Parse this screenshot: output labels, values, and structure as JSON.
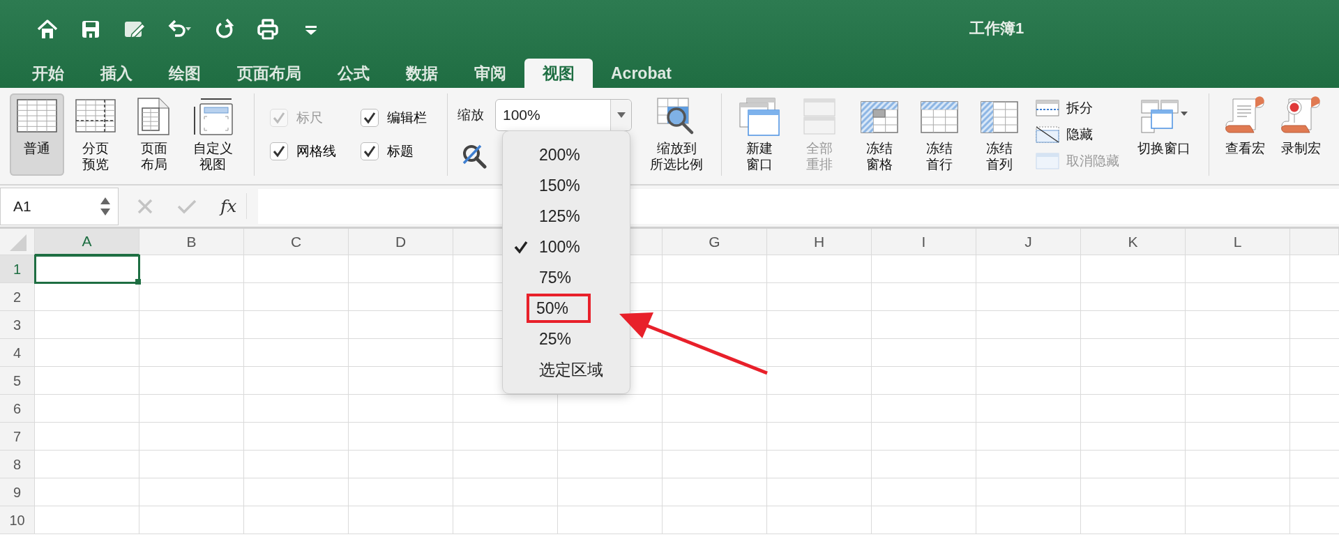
{
  "window": {
    "title": "工作簿1"
  },
  "quick_access": [
    {
      "kind": "home"
    },
    {
      "kind": "save"
    },
    {
      "kind": "edit"
    },
    {
      "kind": "undo"
    },
    {
      "kind": "redo"
    },
    {
      "kind": "print"
    },
    {
      "kind": "customize"
    }
  ],
  "tabs": [
    {
      "label": "开始",
      "selected": false
    },
    {
      "label": "插入",
      "selected": false
    },
    {
      "label": "绘图",
      "selected": false
    },
    {
      "label": "页面布局",
      "selected": false
    },
    {
      "label": "公式",
      "selected": false
    },
    {
      "label": "数据",
      "selected": false
    },
    {
      "label": "审阅",
      "selected": false
    },
    {
      "label": "视图",
      "selected": true
    },
    {
      "label": "Acrobat",
      "selected": false
    }
  ],
  "ribbon": {
    "views": [
      {
        "kind": "normal",
        "lines": [
          "普通"
        ],
        "selected": true
      },
      {
        "kind": "page-break",
        "lines": [
          "分页",
          "预览"
        ],
        "selected": false
      },
      {
        "kind": "page-layout",
        "lines": [
          "页面",
          "布局"
        ],
        "selected": false
      },
      {
        "kind": "custom",
        "lines": [
          "自定义",
          "视图"
        ],
        "selected": false
      }
    ],
    "show": [
      {
        "label": "标尺",
        "checked": true,
        "disabled": true
      },
      {
        "label": "编辑栏",
        "checked": true,
        "disabled": false
      },
      {
        "label": "网格线",
        "checked": true,
        "disabled": false
      },
      {
        "label": "标题",
        "checked": true,
        "disabled": false
      }
    ],
    "zoom": {
      "label": "缩放",
      "value": "100%"
    },
    "zoom_to_selection": {
      "lines": [
        "缩放到",
        "所选比例"
      ]
    },
    "windows": [
      {
        "kind": "new-window",
        "lines": [
          "新建",
          "窗口"
        ],
        "disabled": false
      },
      {
        "kind": "arrange",
        "lines": [
          "全部",
          "重排"
        ],
        "disabled": true
      },
      {
        "kind": "freeze-panes",
        "lines": [
          "冻结",
          "窗格"
        ],
        "disabled": false
      },
      {
        "kind": "freeze-row",
        "lines": [
          "冻结",
          "首行"
        ],
        "disabled": false
      },
      {
        "kind": "freeze-column",
        "lines": [
          "冻结",
          "首列"
        ],
        "disabled": false
      }
    ],
    "window_options": [
      {
        "kind": "split",
        "label": "拆分",
        "disabled": false
      },
      {
        "kind": "hide",
        "label": "隐藏",
        "disabled": false
      },
      {
        "kind": "unhide",
        "label": "取消隐藏",
        "disabled": true
      }
    ],
    "switch_window": {
      "label": "切换窗口"
    },
    "macros": [
      {
        "kind": "view",
        "label": "查看宏"
      },
      {
        "kind": "record",
        "label": "录制宏"
      }
    ]
  },
  "formula_bar": {
    "name_box": "A1",
    "function_label": "fx"
  },
  "sheet": {
    "columns": [
      {
        "label": "A",
        "selected": true
      },
      {
        "label": "B",
        "selected": false
      },
      {
        "label": "C",
        "selected": false
      },
      {
        "label": "D",
        "selected": false
      },
      {
        "selected": false
      },
      {
        "selected": false
      },
      {
        "label": "G",
        "selected": false
      },
      {
        "label": "H",
        "selected": false
      },
      {
        "label": "I",
        "selected": false
      },
      {
        "label": "J",
        "selected": false
      },
      {
        "label": "K",
        "selected": false
      },
      {
        "label": "L",
        "selected": false
      }
    ],
    "rows": [
      {
        "label": "1",
        "selected": true
      },
      {
        "label": "2",
        "selected": false
      },
      {
        "label": "3",
        "selected": false
      },
      {
        "label": "4",
        "selected": false
      },
      {
        "label": "5",
        "selected": false
      },
      {
        "label": "6",
        "selected": false
      },
      {
        "label": "7",
        "selected": false
      },
      {
        "label": "8",
        "selected": false
      },
      {
        "label": "9",
        "selected": false
      },
      {
        "label": "10",
        "selected": false
      }
    ]
  },
  "zoom_menu": {
    "items": [
      {
        "label": "200%",
        "checked": false,
        "annotated": false
      },
      {
        "label": "150%",
        "checked": false,
        "annotated": false
      },
      {
        "label": "125%",
        "checked": false,
        "annotated": false
      },
      {
        "label": "100%",
        "checked": true,
        "annotated": false
      },
      {
        "label": "75%",
        "checked": false,
        "annotated": false
      },
      {
        "label": "50%",
        "checked": false,
        "annotated": true
      },
      {
        "label": "25%",
        "checked": false,
        "annotated": false
      },
      {
        "label": "选定区域",
        "checked": false,
        "annotated": false
      }
    ]
  }
}
